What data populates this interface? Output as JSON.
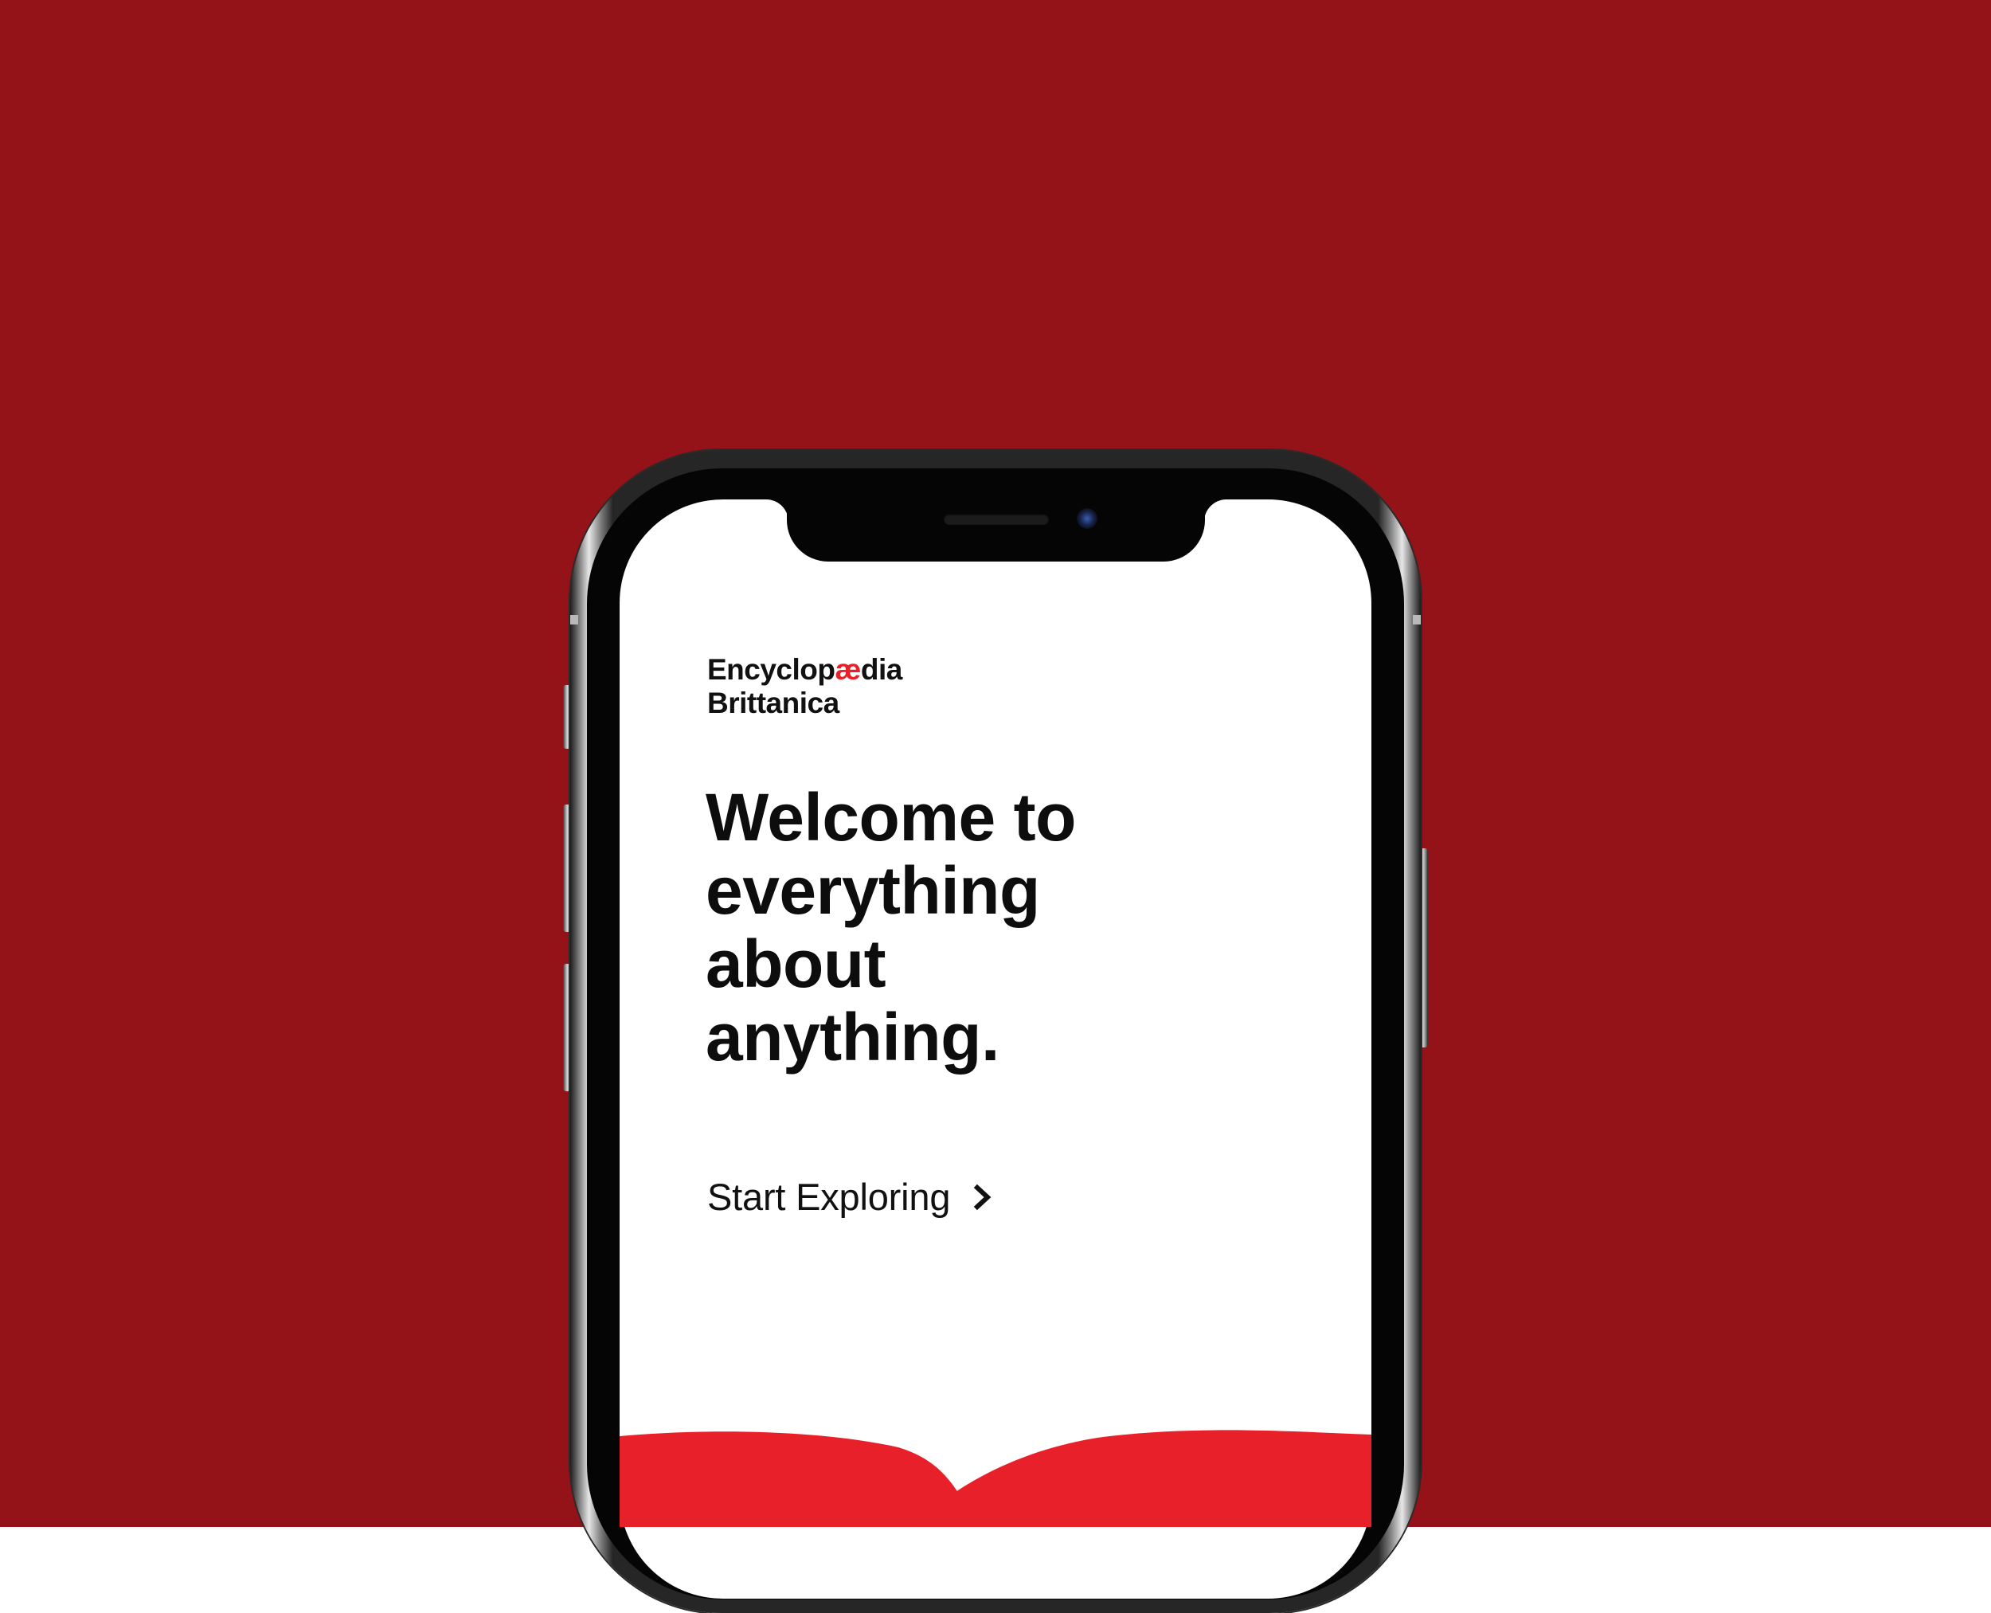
{
  "colors": {
    "background": "#941319",
    "brand_accent": "#e8202a",
    "screen": "#ffffff",
    "text": "#111111",
    "heart": "#e8202a"
  },
  "screen": {
    "brand": {
      "word1_prefix": "Encyclop",
      "word1_accent": "æ",
      "word1_suffix": "dia",
      "word2": "Brittanica"
    },
    "headline": {
      "line1": "Welcome to",
      "line2": "everything",
      "line3": "about",
      "line4": "anything."
    },
    "cta": {
      "label": "Start Exploring",
      "icon": "chevron-right-icon"
    },
    "decoration": "heart-shape"
  }
}
